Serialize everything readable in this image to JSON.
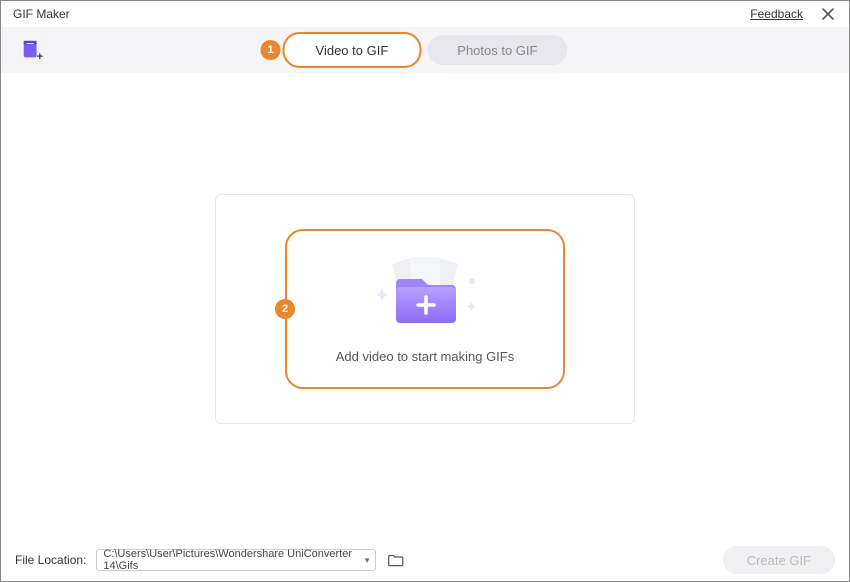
{
  "title": "GIF Maker",
  "feedback": "Feedback",
  "tabs": {
    "video": "Video to GIF",
    "photos": "Photos to GIF"
  },
  "callouts": {
    "one": "1",
    "two": "2"
  },
  "dropzone": {
    "prompt": "Add video to start making GIFs"
  },
  "footer": {
    "label": "File Location:",
    "path": "C:\\Users\\User\\Pictures\\Wondershare UniConverter 14\\Gifs",
    "create": "Create GIF"
  }
}
